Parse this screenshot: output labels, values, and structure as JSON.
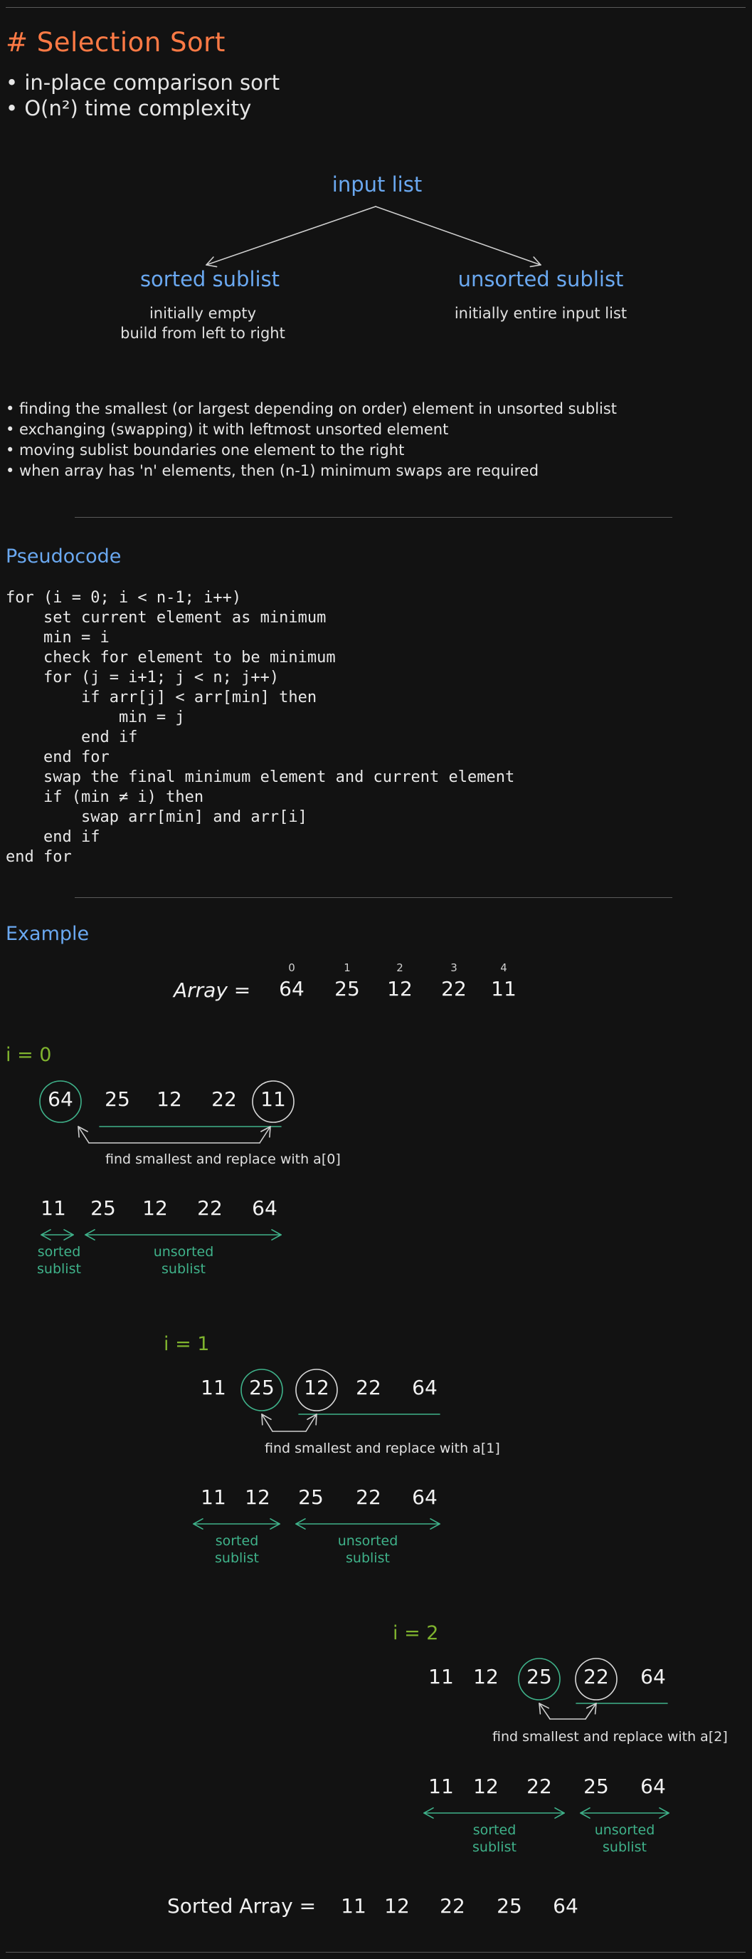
{
  "header": {
    "title": "# Selection Sort",
    "bullets": [
      "• in-place comparison sort",
      "• O(n²) time complexity"
    ]
  },
  "diagram": {
    "root": "input list",
    "left": {
      "title": "sorted sublist",
      "line1": "initially empty",
      "line2": "build from left to right"
    },
    "right": {
      "title": "unsorted sublist",
      "line1": "initially entire input list"
    }
  },
  "steps_bullets": [
    "• finding the smallest (or largest depending on order) element in unsorted sublist",
    "• exchanging (swapping) it with leftmost unsorted element",
    "• moving sublist boundaries one element to the right",
    "• when array has 'n' elements, then (n-1) minimum swaps are required"
  ],
  "pseudocode": {
    "heading": "Pseudocode",
    "lines": [
      "for (i = 0; i < n-1; i++)",
      "    set current element as minimum",
      "    min = i",
      "    check for element to be minimum",
      "    for (j = i+1; j < n; j++)",
      "        if arr[j] < arr[min] then",
      "            min = j",
      "        end if",
      "    end for",
      "    swap the final minimum element and current element",
      "    if (min ≠ i) then",
      "        swap arr[min] and arr[i]",
      "    end if",
      "end for"
    ]
  },
  "example": {
    "heading": "Example",
    "array_label": "Array =",
    "indices": [
      "0",
      "1",
      "2",
      "3",
      "4"
    ],
    "array": [
      "64",
      "25",
      "12",
      "22",
      "11"
    ],
    "iterations": [
      {
        "label": "i = 0",
        "before": [
          "64",
          "25",
          "12",
          "22",
          "11"
        ],
        "caption": "find smallest and replace with a[0]",
        "after": [
          "11",
          "25",
          "12",
          "22",
          "64"
        ],
        "sorted_label": [
          "sorted",
          "sublist"
        ],
        "unsorted_label": [
          "unsorted",
          "sublist"
        ]
      },
      {
        "label": "i = 1",
        "before": [
          "11",
          "25",
          "12",
          "22",
          "64"
        ],
        "caption": "find smallest and replace with a[1]",
        "after": [
          "11",
          "12",
          "25",
          "22",
          "64"
        ],
        "sorted_label": [
          "sorted",
          "sublist"
        ],
        "unsorted_label": [
          "unsorted",
          "sublist"
        ]
      },
      {
        "label": "i = 2",
        "before": [
          "11",
          "12",
          "25",
          "22",
          "64"
        ],
        "caption": "find smallest and replace with a[2]",
        "after": [
          "11",
          "12",
          "22",
          "25",
          "64"
        ],
        "sorted_label": [
          "sorted",
          "sublist"
        ],
        "unsorted_label": [
          "unsorted",
          "sublist"
        ]
      }
    ],
    "sorted_label": "Sorted Array =",
    "sorted": [
      "11",
      "12",
      "22",
      "25",
      "64"
    ]
  },
  "colors": {
    "title": "#ff7a45",
    "heading": "#6aa8f0",
    "iteration": "#7fb32e",
    "sublist": "#3fb28a"
  }
}
